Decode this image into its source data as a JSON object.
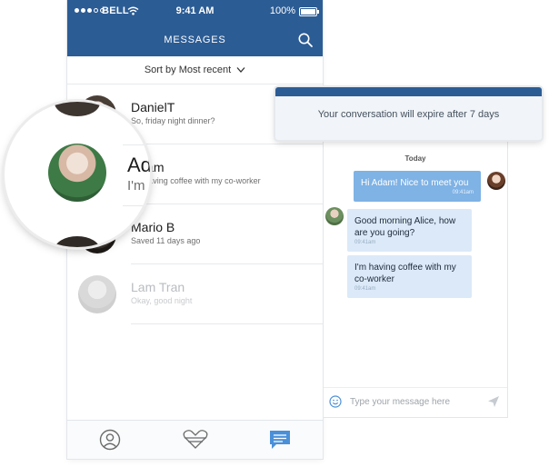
{
  "statusbar": {
    "carrier": "BELL",
    "time": "9:41 AM",
    "battery": "100%"
  },
  "header": {
    "title": "MESSAGES"
  },
  "sort": {
    "label": "Sort by Most recent"
  },
  "conversations": [
    {
      "name": "DanielT",
      "preview": "So, friday night dinner?"
    },
    {
      "name": "Adam",
      "preview": "I'm having coffee with my co-worker"
    },
    {
      "name": "Mario B",
      "preview": "Saved 11 days ago"
    },
    {
      "name": "Lam Tran",
      "preview": "Okay, good night"
    }
  ],
  "magnifier": {
    "name": "Adam",
    "preview_start": "I'm"
  },
  "banner": {
    "text": "Your conversation will expire after 7 days"
  },
  "chat": {
    "day_label": "Today",
    "messages": [
      {
        "text": "Hi Adam! Nice to meet you",
        "time": "09:41am"
      },
      {
        "text": "Good morning Alice, how are you going?",
        "time": "09:41am"
      },
      {
        "text": "I'm having coffee with my co-worker",
        "time": "09:41am"
      }
    ],
    "composer_placeholder": "Type your message here"
  },
  "icons": {
    "search": "search-icon",
    "chevron": "chevron-down-icon",
    "profile_tab": "profile-icon",
    "heart_tab": "heart-icon",
    "messages_tab": "messages-icon",
    "emoji": "smile-icon",
    "send": "send-icon",
    "wifi": "wifi-icon",
    "battery": "battery-icon"
  },
  "colors": {
    "brand": "#2c5c94",
    "outgoing_bubble": "#7fb2e5",
    "incoming_bubble": "#dbe9f8",
    "active_tab": "#4a90d9"
  }
}
